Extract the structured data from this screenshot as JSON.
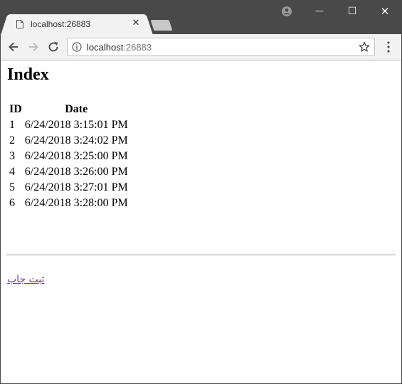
{
  "browser": {
    "tab": {
      "title": "localhost:26883"
    },
    "address_bar": {
      "host": "localhost",
      "port": ":26883"
    },
    "window_controls": {
      "minimize": "—",
      "maximize": "☐",
      "close": "✕"
    },
    "tab_close": "✕"
  },
  "page": {
    "heading": "Index",
    "table": {
      "headers": {
        "id": "ID",
        "date": "Date"
      },
      "rows": [
        {
          "id": "1",
          "date": "6/24/2018 3:15:01 PM"
        },
        {
          "id": "2",
          "date": "6/24/2018 3:24:02 PM"
        },
        {
          "id": "3",
          "date": "6/24/2018 3:25:00 PM"
        },
        {
          "id": "4",
          "date": "6/24/2018 3:26:00 PM"
        },
        {
          "id": "5",
          "date": "6/24/2018 3:27:01 PM"
        },
        {
          "id": "6",
          "date": "6/24/2018 3:28:00 PM"
        }
      ]
    },
    "link_text": "ثبت جاب"
  },
  "colors": {
    "titlebar": "#494949",
    "toolbar": "#f2f2f2",
    "visited_link": "#6a3d8a"
  },
  "icons": [
    "document-icon",
    "close-icon",
    "profile-icon",
    "back-arrow-icon",
    "forward-arrow-icon",
    "reload-icon",
    "info-icon",
    "star-icon",
    "menu-icon"
  ]
}
